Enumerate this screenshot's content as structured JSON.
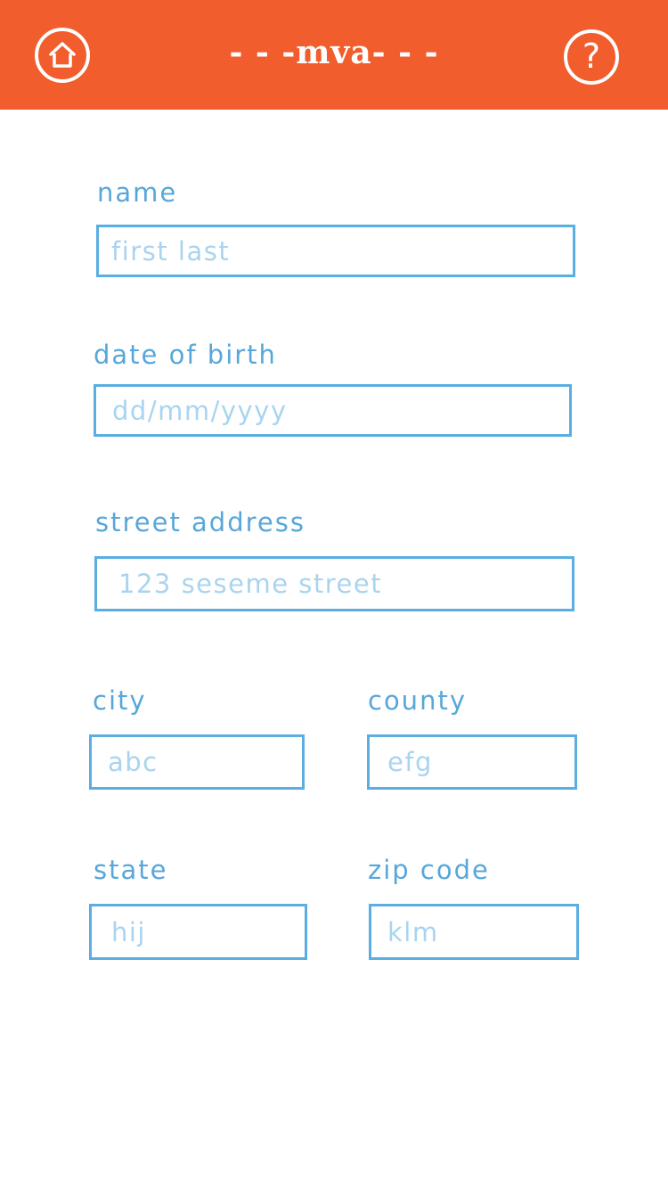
{
  "header": {
    "title": "- - -mva- - -",
    "home_icon": "home-icon",
    "help_icon": "question-mark-icon",
    "help_glyph": "?",
    "background_color": "#f15d2c"
  },
  "form": {
    "name": {
      "label": "name",
      "placeholder": "first last"
    },
    "dob": {
      "label": "date of birth",
      "placeholder": "dd/mm/yyyy"
    },
    "street": {
      "label": "street address",
      "placeholder": "123 seseme street"
    },
    "city": {
      "label": "city",
      "placeholder": "abc"
    },
    "county": {
      "label": "county",
      "placeholder": "efg"
    },
    "state": {
      "label": "state",
      "placeholder": "hij"
    },
    "zip": {
      "label": "zip code",
      "placeholder": "klm"
    }
  },
  "colors": {
    "label": "#58a7da",
    "field_border": "#5aaee2",
    "placeholder": "#a9d4ef"
  }
}
